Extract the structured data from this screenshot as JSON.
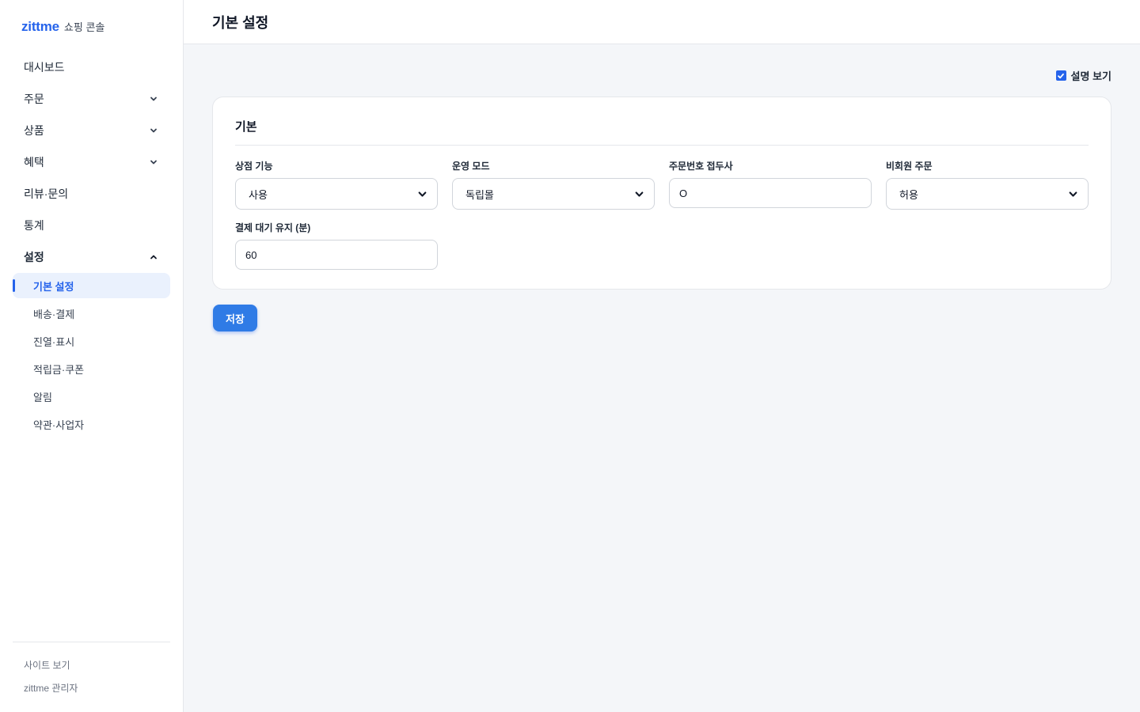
{
  "brand": {
    "logo": "zittme",
    "subtitle": "쇼핑 콘솔"
  },
  "sidebar": {
    "items": [
      {
        "label": "대시보드"
      },
      {
        "label": "주문"
      },
      {
        "label": "상품"
      },
      {
        "label": "혜택"
      },
      {
        "label": "리뷰·문의"
      },
      {
        "label": "통계"
      },
      {
        "label": "설정"
      }
    ],
    "settings_sub": [
      {
        "label": "기본 설정"
      },
      {
        "label": "배송·결제"
      },
      {
        "label": "진열·표시"
      },
      {
        "label": "적립금·쿠폰"
      },
      {
        "label": "알림"
      },
      {
        "label": "약관·사업자"
      }
    ],
    "footer": [
      {
        "label": "사이트 보기"
      },
      {
        "label": "zittme 관리자"
      }
    ]
  },
  "header": {
    "title": "기본 설정"
  },
  "toolbar": {
    "show_description_label": "설명 보기",
    "show_description_checked": true
  },
  "card": {
    "title": "기본",
    "fields": {
      "store_feature": {
        "label": "상점 기능",
        "value": "사용"
      },
      "operation_mode": {
        "label": "운영 모드",
        "value": "독립몰"
      },
      "order_prefix": {
        "label": "주문번호 접두사",
        "value": "O"
      },
      "guest_order": {
        "label": "비회원 주문",
        "value": "허용"
      },
      "payment_wait": {
        "label": "결제 대기 유지 (분)",
        "value": "60"
      }
    }
  },
  "actions": {
    "save_label": "저장"
  },
  "colors": {
    "accent": "#2563eb",
    "button": "#2f7be6",
    "background": "#f4f6f9"
  }
}
